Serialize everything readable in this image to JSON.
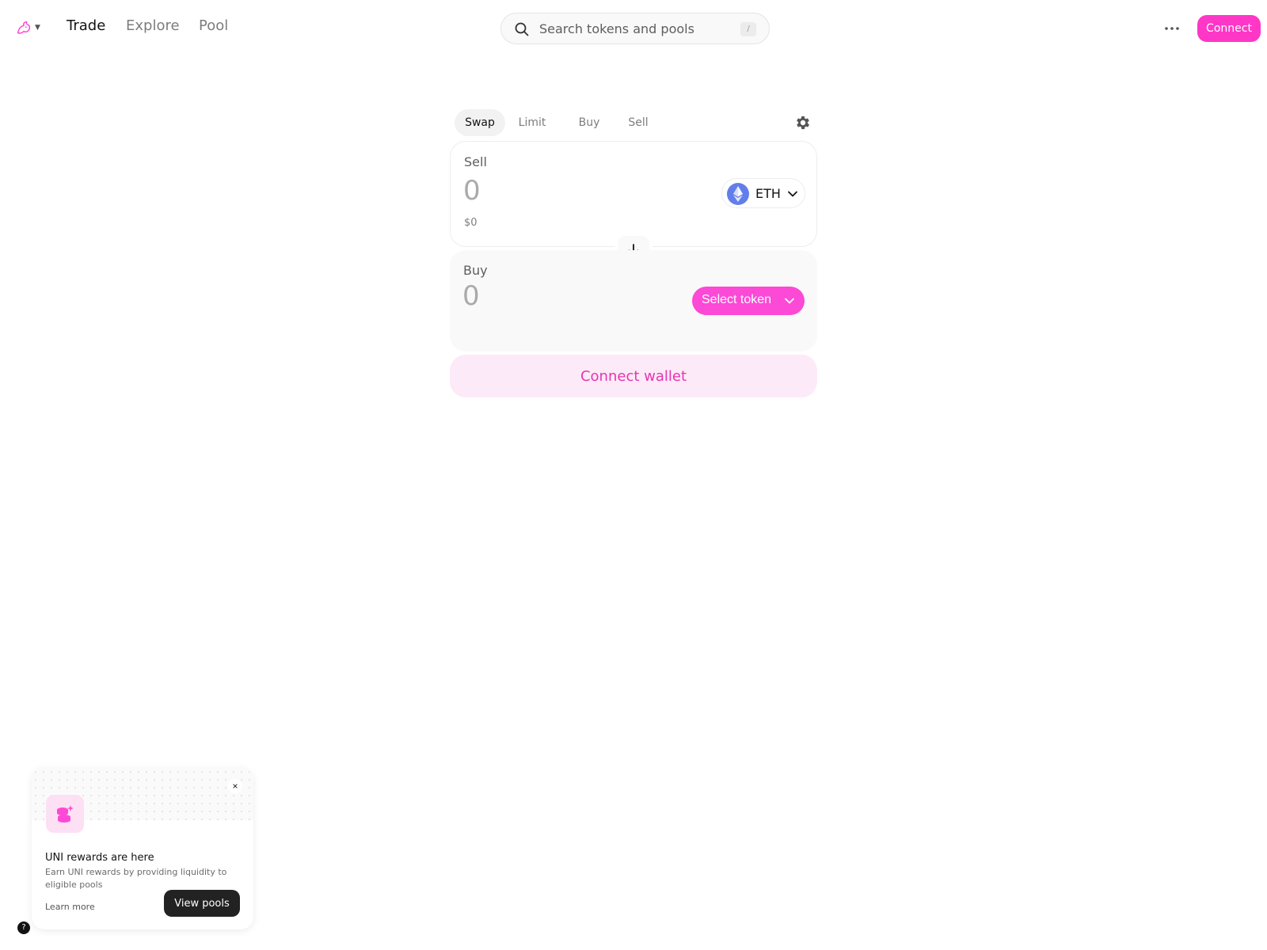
{
  "header": {
    "logo_icon": "uniswap-unicorn-icon",
    "nav": [
      "Trade",
      "Explore",
      "Pool"
    ],
    "search": {
      "placeholder": "Search tokens and pools",
      "shortcut": "/"
    },
    "more_icon": "ellipsis-icon",
    "connect_label": "Connect"
  },
  "swap": {
    "tabs": [
      "Swap",
      "Limit",
      "Buy",
      "Sell"
    ],
    "active_tab": "Swap",
    "settings_icon": "gear-icon",
    "sell": {
      "label": "Sell",
      "amount": "0",
      "usd_value": "$0",
      "token": "ETH"
    },
    "buy": {
      "label": "Buy",
      "amount": "0",
      "select_label": "Select token"
    },
    "connect_wallet_label": "Connect wallet"
  },
  "promo": {
    "title": "UNI rewards are here",
    "description": "Earn UNI rewards by providing liquidity to eligible pools",
    "learn_more": "Learn more",
    "view_pools": "View pools",
    "close": "×"
  },
  "help": "?",
  "colors": {
    "accent": "#fc49d6",
    "accent_soft": "#fdeaf8",
    "eth": "#627eea"
  }
}
